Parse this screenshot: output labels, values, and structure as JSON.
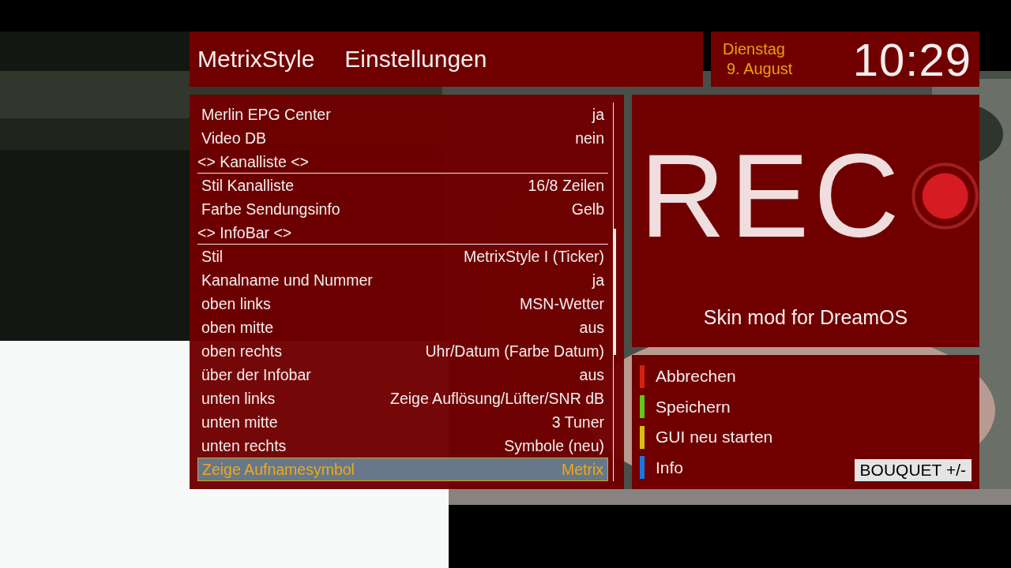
{
  "header": {
    "title": "MetrixStyle",
    "subtitle": "Einstellungen"
  },
  "clock": {
    "weekday": "Dienstag",
    "date": "9. August",
    "time": "10:29"
  },
  "settings": [
    {
      "kind": "option",
      "label": "Merlin EPG Center",
      "value": "ja",
      "selected": false
    },
    {
      "kind": "option",
      "label": "Video DB",
      "value": "nein",
      "selected": false
    },
    {
      "kind": "section",
      "label": "<> Kanalliste <>",
      "selected": false
    },
    {
      "kind": "option",
      "label": "Stil Kanalliste",
      "value": "16/8 Zeilen",
      "selected": false
    },
    {
      "kind": "option",
      "label": "Farbe Sendungsinfo",
      "value": "Gelb",
      "selected": false
    },
    {
      "kind": "section",
      "label": "<> InfoBar <>",
      "selected": false
    },
    {
      "kind": "option",
      "label": "Stil",
      "value": "MetrixStyle I (Ticker)",
      "selected": false
    },
    {
      "kind": "option",
      "label": "Kanalname und Nummer",
      "value": "ja",
      "selected": false
    },
    {
      "kind": "option",
      "label": "oben links",
      "value": "MSN-Wetter",
      "selected": false
    },
    {
      "kind": "option",
      "label": "oben mitte",
      "value": "aus",
      "selected": false
    },
    {
      "kind": "option",
      "label": "oben rechts",
      "value": "Uhr/Datum (Farbe Datum)",
      "selected": false
    },
    {
      "kind": "option",
      "label": "über der Infobar",
      "value": "aus",
      "selected": false
    },
    {
      "kind": "option",
      "label": "unten links",
      "value": "Zeige Auflösung/Lüfter/SNR dB",
      "selected": false
    },
    {
      "kind": "option",
      "label": "unten mitte",
      "value": "3 Tuner",
      "selected": false
    },
    {
      "kind": "option",
      "label": "unten rechts",
      "value": "Symbole (neu)",
      "selected": false
    },
    {
      "kind": "option",
      "label": "Zeige Aufnamesymbol",
      "value": "Metrix",
      "selected": true
    }
  ],
  "preview": {
    "text": "REC",
    "caption": "Skin mod for DreamOS"
  },
  "color_buttons": [
    {
      "label": "Abbrechen",
      "color": "#d42010"
    },
    {
      "label": "Speichern",
      "color": "#60c818"
    },
    {
      "label": "GUI neu starten",
      "color": "#d8c010"
    },
    {
      "label": "Info",
      "color": "#1878e0"
    }
  ],
  "key_hint": "BOUQUET +/-"
}
